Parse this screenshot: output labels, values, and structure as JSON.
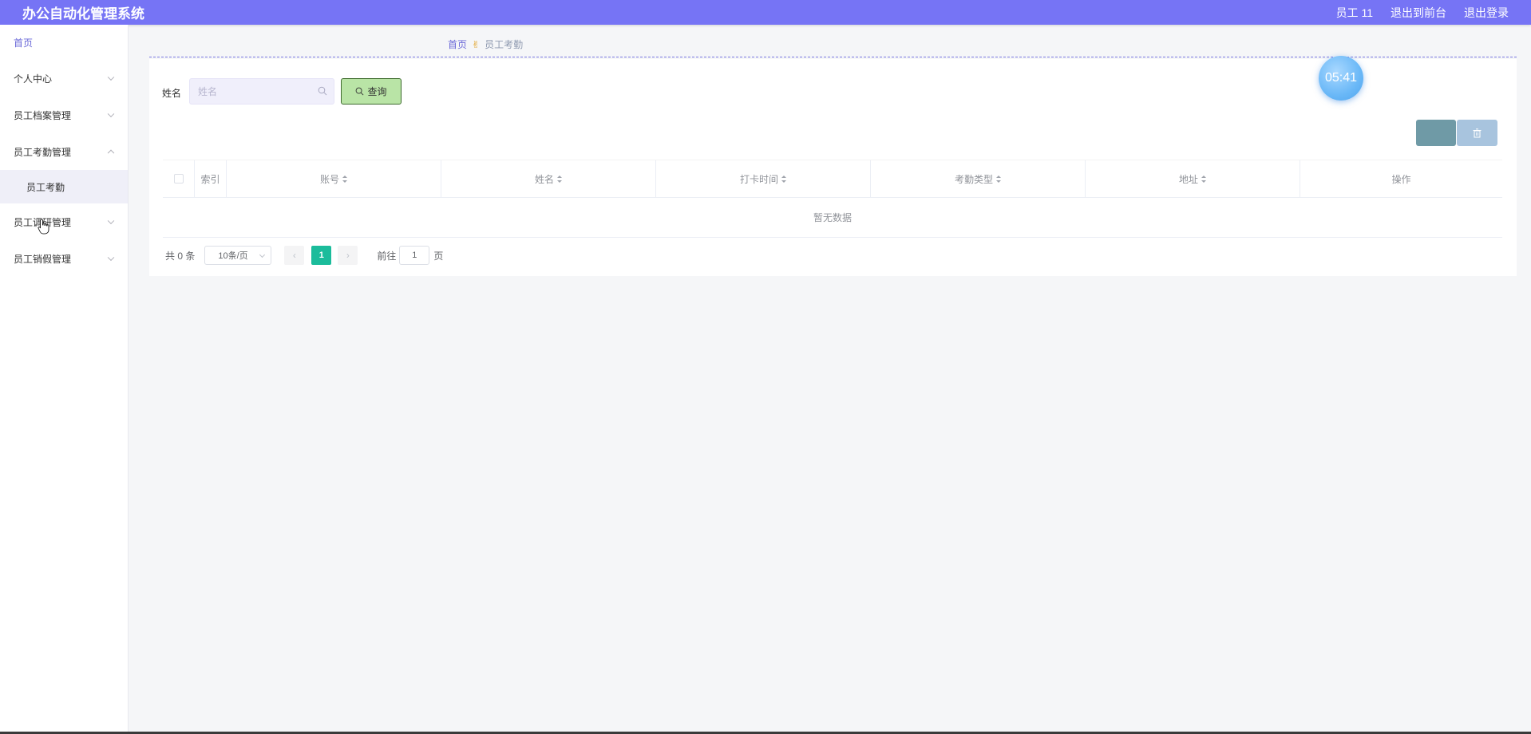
{
  "header": {
    "app_title": "办公自动化管理系统",
    "user_label": "员工 11",
    "back_to_front": "退出到前台",
    "logout": "退出登录"
  },
  "sidebar": {
    "items": [
      {
        "label": "首页"
      },
      {
        "label": "个人中心"
      },
      {
        "label": "员工档案管理"
      },
      {
        "label": "员工考勤管理"
      },
      {
        "label": "员工考勤"
      },
      {
        "label": "员工调研管理"
      },
      {
        "label": "员工销假管理"
      }
    ]
  },
  "breadcrumb": {
    "home": "首页",
    "current": "员工考勤"
  },
  "search": {
    "label": "姓名",
    "placeholder": "姓名",
    "value": "",
    "query_button": "查询"
  },
  "table": {
    "columns": [
      "索引",
      "账号",
      "姓名",
      "打卡时间",
      "考勤类型",
      "地址",
      "操作"
    ],
    "empty_text": "暂无数据"
  },
  "pagination": {
    "total_text": "共 0 条",
    "page_size": "10条/页",
    "current_page": "1",
    "goto_prefix": "前往",
    "goto_value": "1",
    "goto_suffix": "页"
  },
  "timer": {
    "text": "05:41"
  },
  "colors": {
    "header_bg": "#7674f5",
    "query_button_bg": "#b9e4a6",
    "page_active": "#1bbc9b",
    "timer_bg": "#6ab8f7"
  }
}
